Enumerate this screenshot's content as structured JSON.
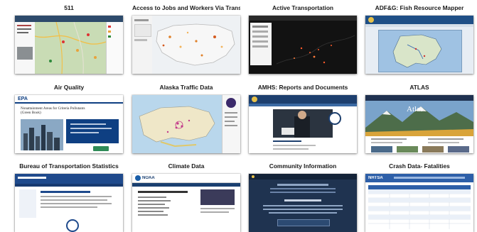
{
  "tiles": [
    {
      "title": "511"
    },
    {
      "title": "Access to Jobs and Workers Via Transit"
    },
    {
      "title": "Active Transportation"
    },
    {
      "title": "ADF&G: Fish Resource Mapper"
    },
    {
      "title": "Air Quality"
    },
    {
      "title": "Alaska Traffic Data"
    },
    {
      "title": "AMHS: Reports and Documents"
    },
    {
      "title": "ATLAS"
    },
    {
      "title": "Bureau of Transportation Statistics"
    },
    {
      "title": "Climate Data"
    },
    {
      "title": "Community Information"
    },
    {
      "title": "Crash Data- Fatalities"
    }
  ],
  "thumb_text": {
    "epa_logo": "EPA",
    "epa_heading": "Nonattainment Areas for Criteria Pollutants (Green Book)",
    "atlas_word": "Atlas",
    "noaa_logo": "NOAA",
    "nhtsa_logo": "NHTSA"
  },
  "colors": {
    "map_green": "#c9dcb5",
    "dark_map": "#121212",
    "epa_blue": "#0e3f82",
    "atlas_sky": "#5b88b5",
    "bts_blue": "#1f4a8c",
    "community_navy": "#1f3350",
    "nhtsa_blue": "#2d5fa8"
  }
}
